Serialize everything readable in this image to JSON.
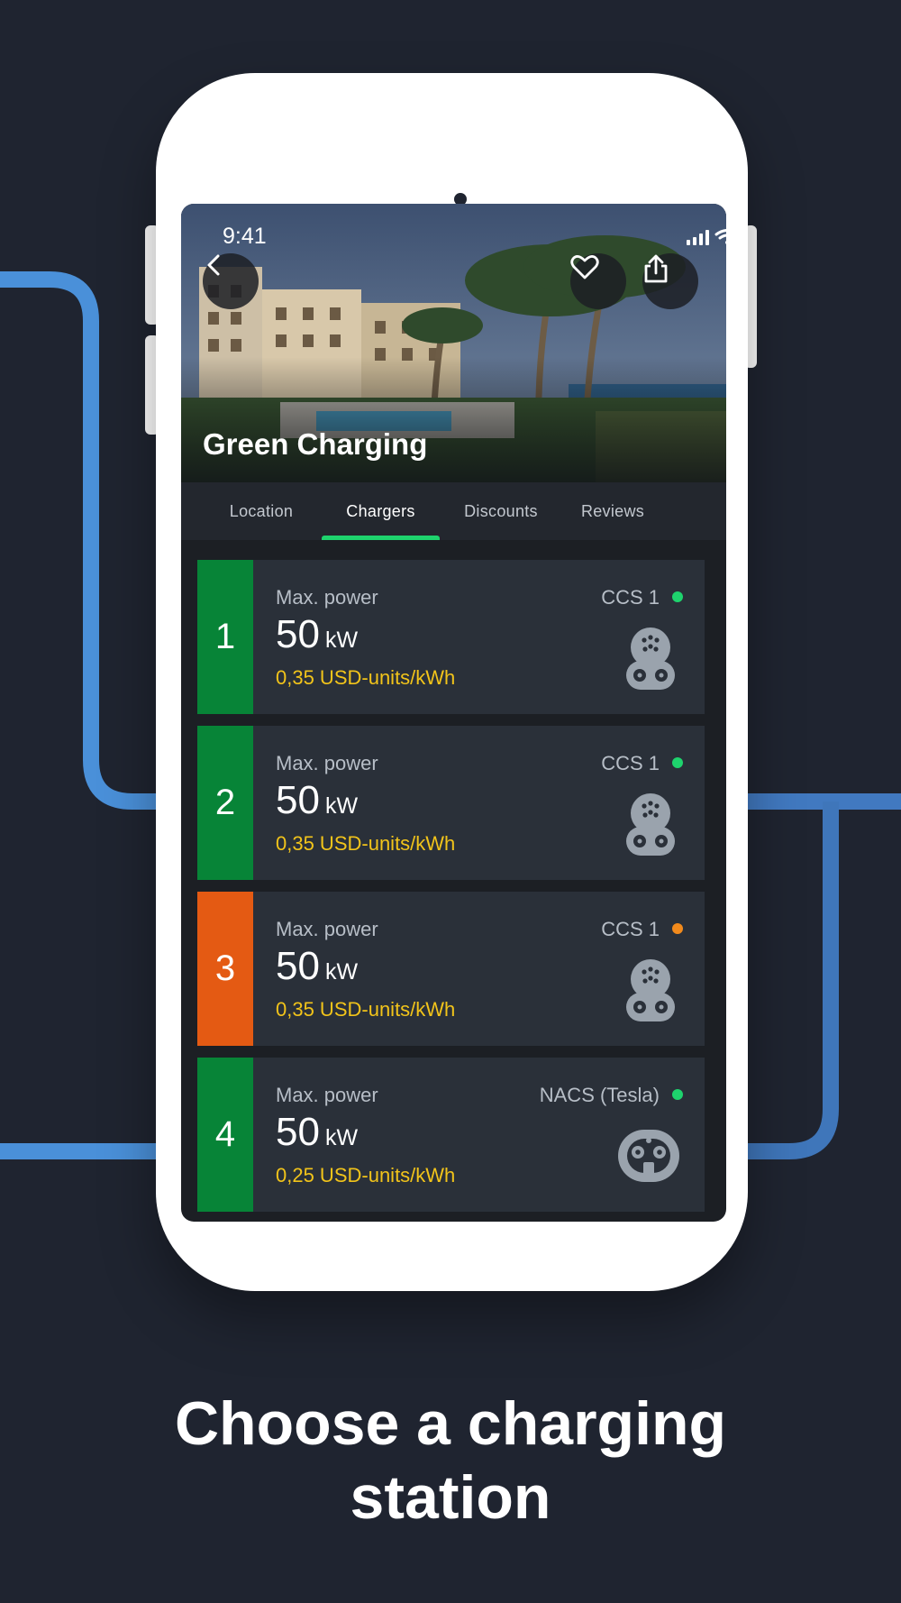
{
  "status_bar": {
    "time": "9:41"
  },
  "station": {
    "name": "Green Charging"
  },
  "tabs": [
    {
      "label": "Location",
      "active": false
    },
    {
      "label": "Chargers",
      "active": true
    },
    {
      "label": "Discounts",
      "active": false
    },
    {
      "label": "Reviews",
      "active": false
    }
  ],
  "chargers": [
    {
      "number": "1",
      "power_label": "Max. power",
      "power_value": "50",
      "power_unit": "kW",
      "price": "0,35 USD-units/kWh",
      "connector": "CCS 1",
      "status_color": "#1ed36d",
      "bar_color": "#078437",
      "icon": "ccs1-connector-icon"
    },
    {
      "number": "2",
      "power_label": "Max. power",
      "power_value": "50",
      "power_unit": "kW",
      "price": "0,35 USD-units/kWh",
      "connector": "CCS 1",
      "status_color": "#1ed36d",
      "bar_color": "#078437",
      "icon": "ccs1-connector-icon"
    },
    {
      "number": "3",
      "power_label": "Max. power",
      "power_value": "50",
      "power_unit": "kW",
      "price": "0,35 USD-units/kWh",
      "connector": "CCS 1",
      "status_color": "#f28a1c",
      "bar_color": "#e45a13",
      "icon": "ccs1-connector-icon"
    },
    {
      "number": "4",
      "power_label": "Max. power",
      "power_value": "50",
      "power_unit": "kW",
      "price": "0,25 USD-units/kWh",
      "connector": "NACS (Tesla)",
      "status_color": "#1ed36d",
      "bar_color": "#078437",
      "icon": "nacs-connector-icon"
    }
  ],
  "caption": {
    "line1": "Choose a charging",
    "line2": "station"
  },
  "colors": {
    "background": "#1f2430",
    "accent": "#1ed36d",
    "price": "#f2c41a",
    "deco_line": "#4a90d9"
  }
}
